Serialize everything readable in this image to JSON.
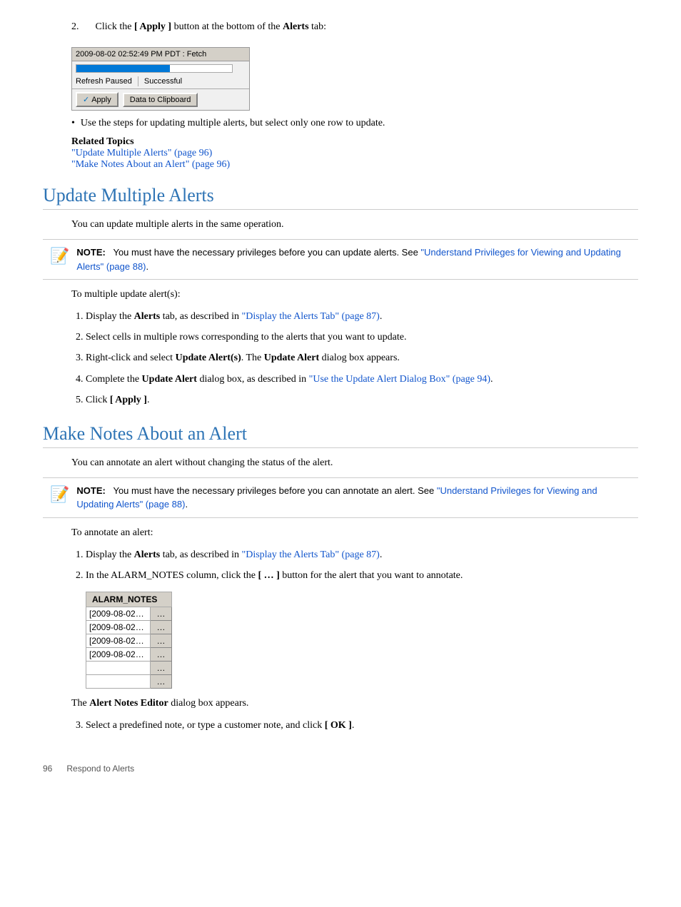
{
  "page": {
    "footer": {
      "page_num": "96",
      "section": "Respond to Alerts"
    }
  },
  "step2_intro": "Click the [ Apply ] button at the bottom of the Alerts tab:",
  "screenshot": {
    "toolbar_text": "2009-08-02 02:52:49 PM PDT : Fetch",
    "status_left": "Refresh Paused",
    "status_right": "Successful",
    "apply_btn": "Apply",
    "clipboard_btn": "Data to Clipboard"
  },
  "bullet_text": "Use the steps for updating multiple alerts, but select only one row to update.",
  "related_topics": {
    "title": "Related Topics",
    "link1_text": "\"Update Multiple Alerts\" (page 96)",
    "link2_text": "\"Make Notes About an Alert\" (page 96)"
  },
  "section1": {
    "title": "Update Multiple Alerts",
    "intro": "You can update multiple alerts in the same operation.",
    "note": {
      "label": "NOTE:",
      "text": "You must have the necessary privileges before you can update alerts. See \"Understand Privileges for Viewing and Updating Alerts\" (page 88)."
    },
    "to_multiple": "To multiple update alert(s):",
    "steps": [
      {
        "num": "1.",
        "text_plain": "Display the ",
        "bold": "Alerts",
        "text_after": " tab, as described in ",
        "link": "\"Display the Alerts Tab\" (page 87).",
        "link_text": "\"Display the Alerts Tab\" (page 87)."
      },
      {
        "num": "2.",
        "text_plain": "Select cells in multiple rows corresponding to the alerts that you want to update."
      },
      {
        "num": "3.",
        "text_plain": "Right-click and select ",
        "bold": "Update Alert(s)",
        "text_after": ". The ",
        "bold2": "Update Alert",
        "text_after2": " dialog box appears."
      },
      {
        "num": "4.",
        "text_plain": "Complete the ",
        "bold": "Update Alert",
        "text_after": " dialog box, as described in ",
        "link": "\"Use the Update Alert Dialog Box\" (page 94).",
        "link_text": "\"Use the Update Alert Dialog Box\" (page 94)."
      },
      {
        "num": "5.",
        "text_plain": "Click ",
        "bold": "[ Apply ]",
        "text_after": "."
      }
    ]
  },
  "section2": {
    "title": "Make Notes About an Alert",
    "intro": "You can annotate an alert without changing the status of the alert.",
    "note": {
      "label": "NOTE:",
      "text": "You must have the necessary privileges before you can annotate an alert. See \"Understand Privileges for Viewing and Updating Alerts\" (page 88)."
    },
    "to_annotate": "To annotate an alert:",
    "steps": [
      {
        "num": "1.",
        "text_plain": "Display the ",
        "bold": "Alerts",
        "text_after": " tab, as described in ",
        "link_text": "\"Display the Alerts Tab\" (page 87)."
      },
      {
        "num": "2.",
        "text_plain": "In the ALARM_NOTES column, click the ",
        "bold": "[ … ]",
        "text_after": " button for the alert that you want to annotate."
      }
    ],
    "alarm_table": {
      "header": "ALARM_NOTES",
      "rows": [
        {
          "date": "[2009-08-02…",
          "btn": "…"
        },
        {
          "date": "[2009-08-02…",
          "btn": "…"
        },
        {
          "date": "[2009-08-02…",
          "btn": "…"
        },
        {
          "date": "[2009-08-02…",
          "btn": "…"
        },
        {
          "date": "",
          "btn": "…"
        },
        {
          "date": "",
          "btn": "…"
        }
      ]
    },
    "after_table": "The ",
    "after_table_bold": "Alert Notes Editor",
    "after_table_rest": " dialog box appears.",
    "step3_text": "Select a predefined note, or type a customer note, and click ",
    "step3_bold": "[ OK ]",
    "step3_end": "."
  }
}
